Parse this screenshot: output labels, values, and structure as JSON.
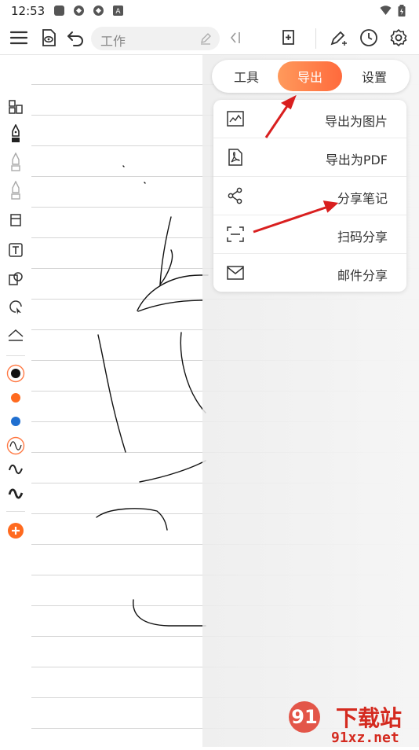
{
  "status_bar": {
    "time": "12:53",
    "notification_badge": "A"
  },
  "toolbar": {
    "title": "工作"
  },
  "panel": {
    "tabs": [
      {
        "label": "工具",
        "active": false
      },
      {
        "label": "导出",
        "active": true
      },
      {
        "label": "设置",
        "active": false
      }
    ],
    "menu": [
      {
        "label": "导出为图片",
        "icon": "image-export-icon"
      },
      {
        "label": "导出为PDF",
        "icon": "pdf-icon"
      },
      {
        "label": "分享笔记",
        "icon": "share-icon"
      },
      {
        "label": "扫码分享",
        "icon": "scan-icon"
      },
      {
        "label": "邮件分享",
        "icon": "mail-icon"
      }
    ]
  },
  "palette": {
    "black": "#111111",
    "orange": "#ff6a1f",
    "blue": "#1f6fd0",
    "accent": "#ff7a45"
  },
  "watermark": {
    "brand": "下载站",
    "domain": "91xz.net"
  }
}
